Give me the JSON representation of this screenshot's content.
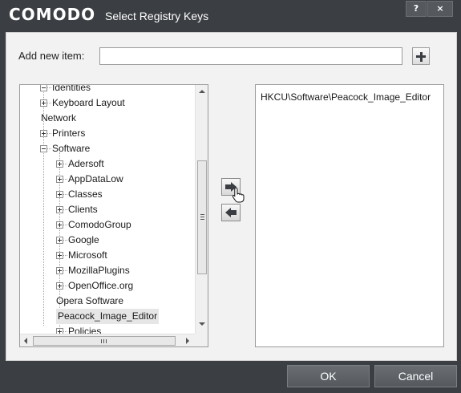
{
  "titlebar": {
    "brand": "COMODO",
    "title": "Select Registry Keys",
    "help_label": "?",
    "close_label": "×"
  },
  "add_item": {
    "label": "Add new item:",
    "value": "",
    "placeholder": ""
  },
  "tree": {
    "items": [
      {
        "label": "Identities",
        "expander": "minus"
      },
      {
        "label": "Keyboard Layout",
        "expander": "plus"
      },
      {
        "label": "Network",
        "expander": "none"
      },
      {
        "label": "Printers",
        "expander": "plus"
      },
      {
        "label": "Software",
        "expander": "minus"
      },
      {
        "label": "Adersoft",
        "expander": "plus"
      },
      {
        "label": "AppDataLow",
        "expander": "plus"
      },
      {
        "label": "Classes",
        "expander": "plus"
      },
      {
        "label": "Clients",
        "expander": "plus"
      },
      {
        "label": "ComodoGroup",
        "expander": "plus"
      },
      {
        "label": "Google",
        "expander": "plus"
      },
      {
        "label": "Microsoft",
        "expander": "plus"
      },
      {
        "label": "MozillaPlugins",
        "expander": "plus"
      },
      {
        "label": "OpenOffice.org",
        "expander": "plus"
      },
      {
        "label": "Opera Software",
        "expander": "none"
      },
      {
        "label": "Peacock_Image_Editor",
        "expander": "none",
        "selected": true
      },
      {
        "label": "Policies",
        "expander": "plus"
      }
    ]
  },
  "selected_list": {
    "items": [
      "HKCU\\Software\\Peacock_Image_Editor"
    ]
  },
  "footer": {
    "ok_label": "OK",
    "cancel_label": "Cancel"
  },
  "colors": {
    "frame": "#3b3e42",
    "panel": "#f2f2f2",
    "selection": "#e6e6e6"
  }
}
